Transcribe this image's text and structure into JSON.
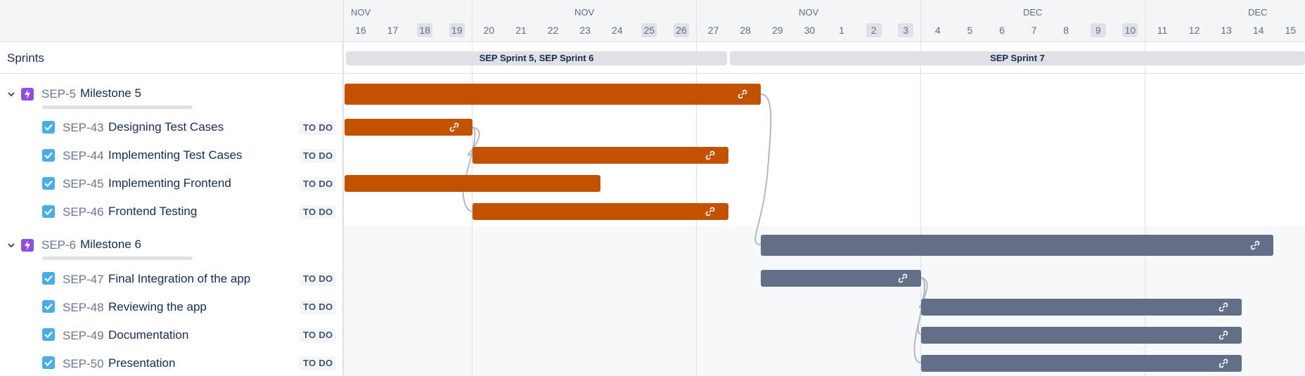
{
  "left": {
    "sprints_label": "Sprints"
  },
  "timeline": {
    "months": [
      "NOV",
      "NOV",
      "NOV",
      "DEC",
      "DEC"
    ],
    "days": [
      "16",
      "17",
      "18",
      "19",
      "20",
      "21",
      "22",
      "23",
      "24",
      "25",
      "26",
      "27",
      "28",
      "29",
      "30",
      "1",
      "2",
      "3",
      "4",
      "5",
      "6",
      "7",
      "8",
      "9",
      "10",
      "11",
      "12",
      "13",
      "14",
      "15"
    ],
    "weekend_days": [
      "18",
      "19",
      "25",
      "26",
      "2",
      "3",
      "9",
      "10"
    ]
  },
  "sprints": [
    {
      "label": "SEP Sprint 5, SEP Sprint 6"
    },
    {
      "label": "SEP Sprint 7"
    }
  ],
  "epics": [
    {
      "key": "SEP-5",
      "summary": "Milestone 5",
      "color": "#c25100",
      "children": [
        {
          "key": "SEP-43",
          "summary": "Designing Test Cases",
          "status": "TO DO"
        },
        {
          "key": "SEP-44",
          "summary": "Implementing Test Cases",
          "status": "TO DO"
        },
        {
          "key": "SEP-45",
          "summary": "Implementing Frontend",
          "status": "TO DO"
        },
        {
          "key": "SEP-46",
          "summary": "Frontend Testing",
          "status": "TO DO"
        }
      ]
    },
    {
      "key": "SEP-6",
      "summary": "Milestone 6",
      "color": "#626f86",
      "children": [
        {
          "key": "SEP-47",
          "summary": "Final Integration of the app",
          "status": "TO DO"
        },
        {
          "key": "SEP-48",
          "summary": "Reviewing the app",
          "status": "TO DO"
        },
        {
          "key": "SEP-49",
          "summary": "Documentation",
          "status": "TO DO"
        },
        {
          "key": "SEP-50",
          "summary": "Presentation",
          "status": "TO DO"
        }
      ]
    }
  ],
  "icons": {
    "epic": "lightning-icon",
    "task": "checkbox-icon",
    "expand": "chevron-down-icon",
    "dependency": "link-icon"
  },
  "colors": {
    "accent_orange": "#c25100",
    "accent_gray": "#626f86",
    "epic_purple": "#904ee2",
    "task_blue": "#4bade8"
  }
}
